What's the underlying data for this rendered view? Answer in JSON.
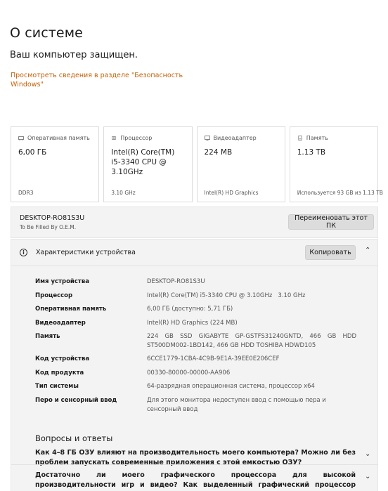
{
  "page": {
    "title": "О системе",
    "status": "Ваш компьютер защищен.",
    "security_link": "Просмотреть сведения в разделе \"Безопасность Windows\""
  },
  "cards": [
    {
      "icon": "memory-icon",
      "label": "Оперативная память",
      "value": "6,00 ГБ",
      "footer": "DDR3"
    },
    {
      "icon": "processor-icon",
      "label": "Процессор",
      "value": "Intel(R) Core(TM) i5-3340 CPU @ 3.10GHz",
      "footer": "3.10 GHz"
    },
    {
      "icon": "display-adapter-icon",
      "label": "Видеоадаптер",
      "value": "224 MB",
      "footer": "Intel(R) HD Graphics"
    },
    {
      "icon": "storage-icon",
      "label": "Память",
      "value": "1.13 TB",
      "footer": "Используется 93 GB из 1.13 TB"
    }
  ],
  "device": {
    "name": "DESKTOP-RO81S3U",
    "subtitle": "To Be Filled By O.E.M.",
    "rename_label": "Переименовать этот ПК"
  },
  "specs": {
    "title": "Характеристики устройства",
    "copy_label": "Копировать",
    "rows": [
      {
        "key": "Имя устройства",
        "value": "DESKTOP-RO81S3U"
      },
      {
        "key": "Процессор",
        "value": "Intel(R) Core(TM) i5-3340 CPU @ 3.10GHz   3.10 GHz"
      },
      {
        "key": "Оперативная память",
        "value": "6,00 ГБ (доступно: 5,71 ГБ)"
      },
      {
        "key": "Видеоадаптер",
        "value": "Intel(R) HD Graphics (224 MB)"
      },
      {
        "key": "Память",
        "value": "224 GB SSD GIGABYTE GP-GSTFS31240GNTD, 466 GB HDD ST500DM002-1BD142, 466 GB HDD TOSHIBA HDWD105"
      },
      {
        "key": "Код устройства",
        "value": "6CCE1779-1CBA-4C9B-9E1A-39EE0E206CEF"
      },
      {
        "key": "Код продукта",
        "value": "00330-80000-00000-AA906"
      },
      {
        "key": "Тип системы",
        "value": "64-разрядная операционная система, процессор x64"
      },
      {
        "key": "Перо и сенсорный ввод",
        "value": "Для этого монитора недоступен ввод с помощью пера и сенсорный ввод"
      }
    ]
  },
  "faq": {
    "title": "Вопросы и ответы",
    "questions": [
      "Как 4–8 ГБ ОЗУ влияют на производительность моего компьютера? Можно ли без проблем запускать современные приложения с этой емкостью ОЗУ?",
      "Достаточно ли моего графического процессора для высокой производительности игр и видео? Как выделенный графический процессор может повысить удобство работы и"
    ]
  }
}
